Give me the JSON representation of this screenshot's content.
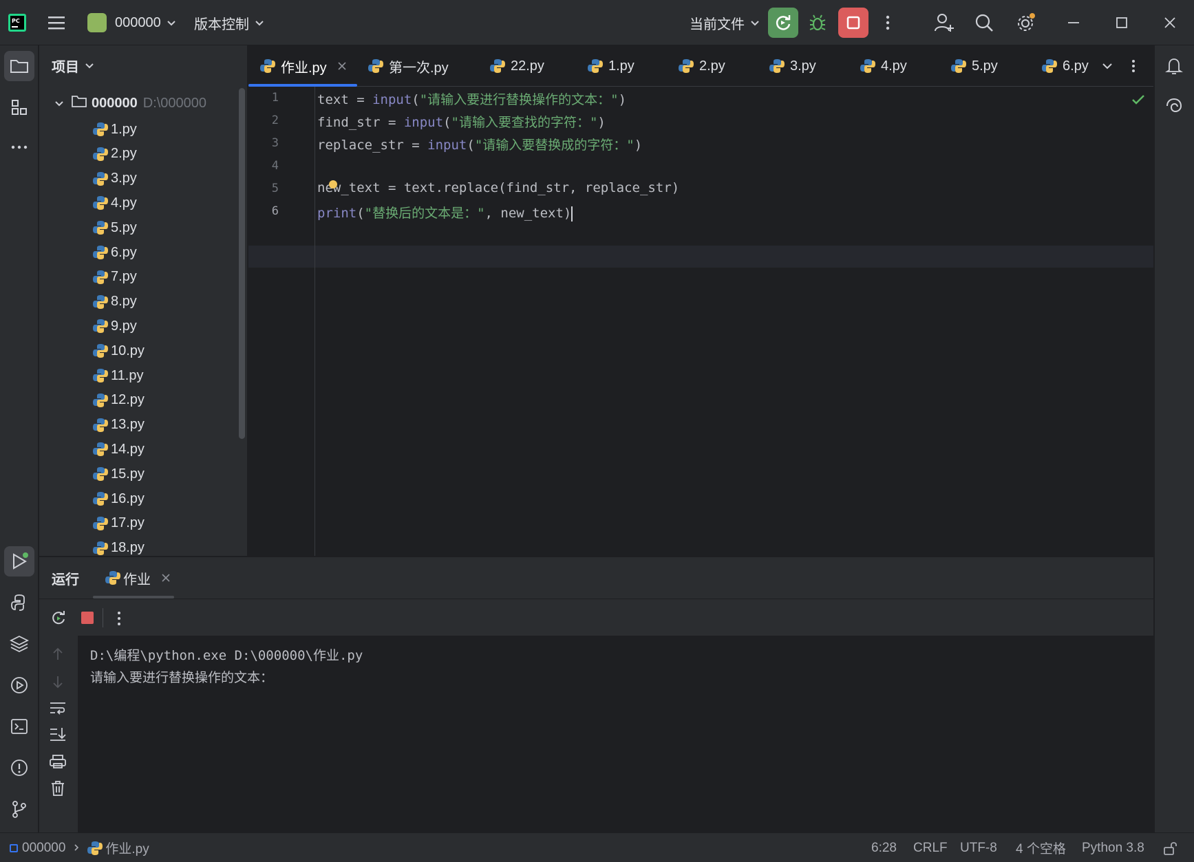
{
  "titlebar": {
    "app_logo": "PC",
    "project_name": "000000",
    "vcs_label": "版本控制",
    "run_config": "当前文件"
  },
  "project_panel": {
    "title": "项目",
    "root_name": "000000",
    "root_path": "D:\\000000",
    "files": [
      "1.py",
      "2.py",
      "3.py",
      "4.py",
      "5.py",
      "6.py",
      "7.py",
      "8.py",
      "9.py",
      "10.py",
      "11.py",
      "12.py",
      "13.py",
      "14.py",
      "15.py",
      "16.py",
      "17.py",
      "18.py"
    ]
  },
  "editor": {
    "tabs": [
      {
        "label": "作业.py",
        "active": true
      },
      {
        "label": "第一次.py"
      },
      {
        "label": "22.py"
      },
      {
        "label": "1.py"
      },
      {
        "label": "2.py"
      },
      {
        "label": "3.py"
      },
      {
        "label": "4.py"
      },
      {
        "label": "5.py"
      },
      {
        "label": "6.py"
      }
    ],
    "line_numbers": [
      "1",
      "2",
      "3",
      "4",
      "5",
      "6"
    ],
    "lines": {
      "l1": {
        "a": "text = ",
        "b": "input",
        "c": "(",
        "d": "\"请输入要进行替换操作的文本：\"",
        "e": ")"
      },
      "l2": {
        "a": "find_str = ",
        "b": "input",
        "c": "(",
        "d": "\"请输入要查找的字符：\"",
        "e": ")"
      },
      "l3": {
        "a": "replace_str = ",
        "b": "input",
        "c": "(",
        "d": "\"请输入要替换成的字符：\"",
        "e": ")"
      },
      "l5": {
        "a": "new_text = text.replace(find_str, replace_str)"
      },
      "l6": {
        "b": "print",
        "c": "(",
        "d": "\"替换后的文本是：\"",
        "e": ", new_text)"
      }
    }
  },
  "run_panel": {
    "title": "运行",
    "tab_label": "作业",
    "console": [
      "D:\\编程\\python.exe D:\\000000\\作业.py",
      "请输入要进行替换操作的文本："
    ]
  },
  "statusbar": {
    "project": "000000",
    "file": "作业.py",
    "position": "6:28",
    "line_sep": "CRLF",
    "encoding": "UTF-8",
    "indent": "4 个空格",
    "interpreter": "Python 3.8"
  },
  "colors": {
    "accent": "#3574f0",
    "run_green": "#57965c",
    "stop_red": "#db5c5c"
  }
}
